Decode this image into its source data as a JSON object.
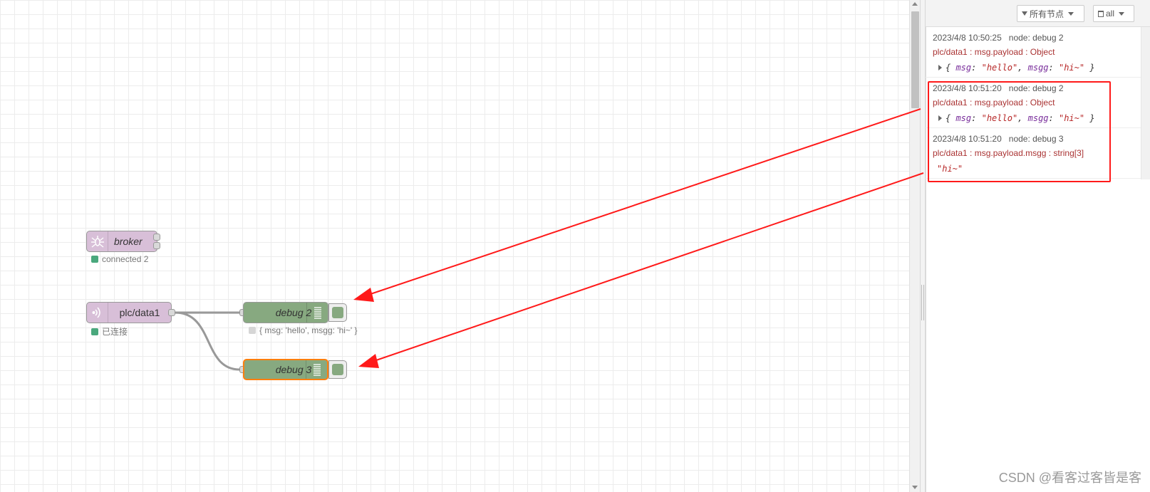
{
  "workspace": {
    "nodes": {
      "broker": {
        "label": "broker",
        "status": "connected 2",
        "status_color": "#4aa87d"
      },
      "plc": {
        "label": "plc/data1",
        "status": "已连接",
        "status_color": "#4aa87d"
      },
      "debug2": {
        "label": "debug 2",
        "status": "{ msg: 'hello', msgg: 'hi~' }"
      },
      "debug3": {
        "label": "debug 3"
      }
    }
  },
  "sidebar": {
    "toolbar": {
      "filter_label": "所有节点",
      "clear_label": "all"
    },
    "messages": [
      {
        "timestamp": "2023/4/8 10:50:25",
        "node": "node: debug 2",
        "topic": "plc/data1 : msg.payload : Object",
        "payload": {
          "open": "{ ",
          "k1": "msg",
          "v1": "\"hello\"",
          "k2": "msgg",
          "v2": "\"hi~\"",
          "close": " }"
        }
      },
      {
        "timestamp": "2023/4/8 10:51:20",
        "node": "node: debug 2",
        "topic": "plc/data1 : msg.payload : Object",
        "payload": {
          "open": "{ ",
          "k1": "msg",
          "v1": "\"hello\"",
          "k2": "msgg",
          "v2": "\"hi~\"",
          "close": " }"
        }
      },
      {
        "timestamp": "2023/4/8 10:51:20",
        "node": "node: debug 3",
        "topic": "plc/data1 : msg.payload.msgg : string[3]",
        "payload_string": "\"hi~\""
      }
    ]
  },
  "annotation_color": "#ff1a1a",
  "watermark": "CSDN @看客过客皆是客"
}
